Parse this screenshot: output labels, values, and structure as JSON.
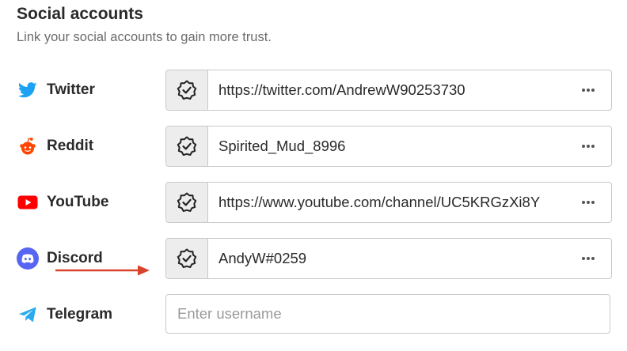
{
  "section": {
    "title": "Social accounts",
    "subtitle": "Link your social accounts to gain more trust."
  },
  "accounts": [
    {
      "platform": "Twitter",
      "icon": "twitter-icon",
      "color": "#1DA1F2",
      "value": "https://twitter.com/AndrewW90253730",
      "verified": true
    },
    {
      "platform": "Reddit",
      "icon": "reddit-icon",
      "color": "#FF4500",
      "value": "Spirited_Mud_8996",
      "verified": true
    },
    {
      "platform": "YouTube",
      "icon": "youtube-icon",
      "color": "#FF0000",
      "value": "https://www.youtube.com/channel/UC5KRGzXi8Y",
      "verified": true
    },
    {
      "platform": "Discord",
      "icon": "discord-icon",
      "color": "#5865F2",
      "value": "AndyW#0259",
      "verified": true
    },
    {
      "platform": "Telegram",
      "icon": "telegram-icon",
      "color": "#2AABEE",
      "value": "",
      "placeholder": "Enter username",
      "verified": false
    }
  ],
  "annotation": {
    "arrow_color": "#D9432B",
    "points_to": "Discord verified field"
  }
}
